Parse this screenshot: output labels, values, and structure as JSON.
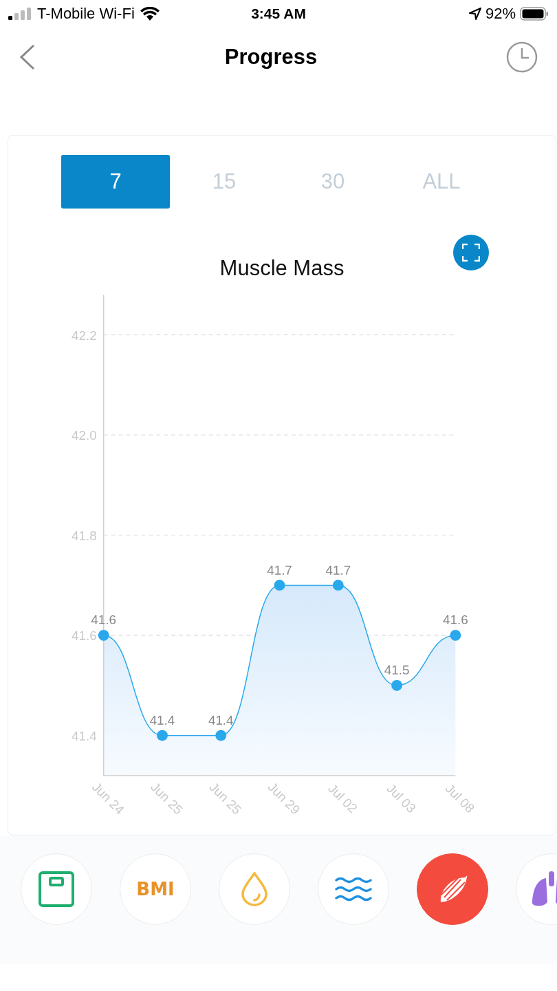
{
  "status_bar": {
    "carrier": "T-Mobile Wi-Fi",
    "time": "3:45 AM",
    "battery": "92%"
  },
  "nav": {
    "title": "Progress"
  },
  "range_tabs": [
    {
      "label": "7",
      "selected": true
    },
    {
      "label": "15",
      "selected": false
    },
    {
      "label": "30",
      "selected": false
    },
    {
      "label": "ALL",
      "selected": false
    }
  ],
  "chart": {
    "chart_data": {
      "type": "area",
      "title": "Muscle Mass",
      "categories": [
        "Jun 24",
        "Jun 25",
        "Jun 25",
        "Jun 29",
        "Jul 02",
        "Jul 03",
        "Jul 08"
      ],
      "series": [
        {
          "color": "#2aa8ec",
          "values": [
            41.6,
            41.4,
            41.4,
            41.7,
            41.7,
            41.5,
            41.6
          ]
        }
      ],
      "ylim": [
        41.32,
        42.28
      ],
      "yticks": [
        41.4,
        41.6,
        41.8,
        {
          "value": 42.0,
          "label": "42.0"
        },
        42.2
      ],
      "grid": true,
      "data_labels": true
    }
  },
  "metrics": [
    {
      "kind": "scale",
      "selected": false
    },
    {
      "kind": "bmi",
      "label": "BMI",
      "selected": false
    },
    {
      "kind": "drop",
      "selected": false
    },
    {
      "kind": "water",
      "selected": false
    },
    {
      "kind": "muscle",
      "selected": true
    },
    {
      "kind": "lungs",
      "selected": false
    }
  ]
}
